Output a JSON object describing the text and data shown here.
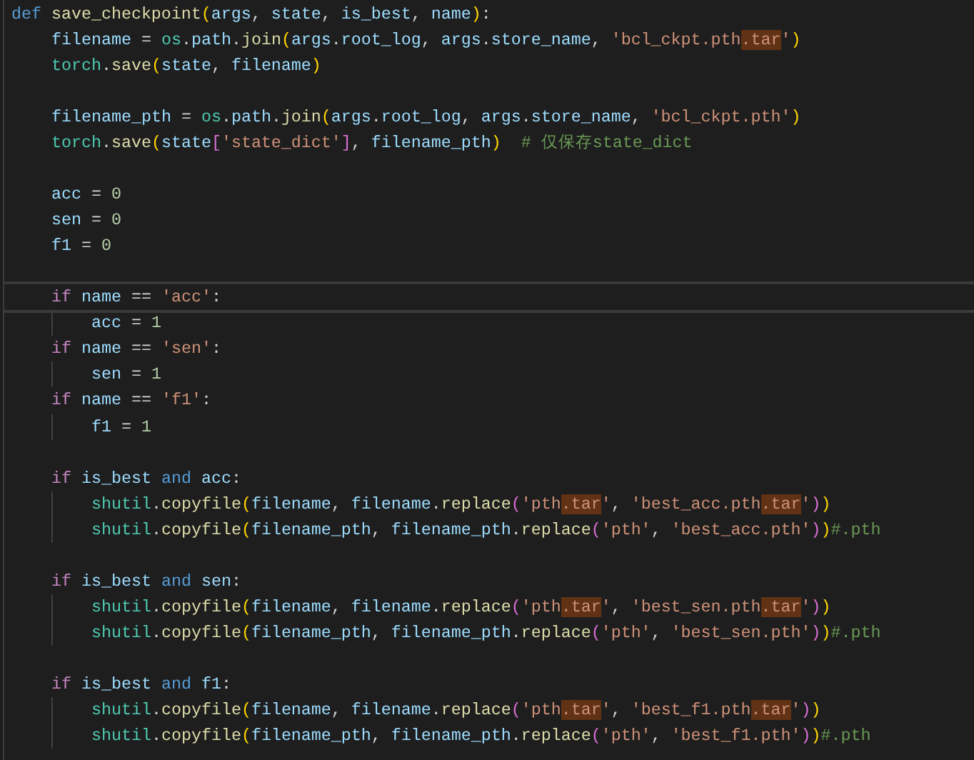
{
  "editor": {
    "lines": [
      {
        "kind": "code",
        "current": false,
        "tokens": [
          {
            "kind": "kw",
            "text": "def "
          },
          {
            "kind": "fn",
            "text": "save_checkpoint"
          },
          {
            "kind": "b1",
            "text": "("
          },
          {
            "kind": "var",
            "text": "args"
          },
          {
            "kind": "op",
            "text": ", "
          },
          {
            "kind": "var",
            "text": "state"
          },
          {
            "kind": "op",
            "text": ", "
          },
          {
            "kind": "var",
            "text": "is_best"
          },
          {
            "kind": "op",
            "text": ", "
          },
          {
            "kind": "var",
            "text": "name"
          },
          {
            "kind": "b1",
            "text": ")"
          },
          {
            "kind": "op",
            "text": ":"
          }
        ],
        "children": [
          {
            "kind": "code",
            "current": false,
            "tokens": [
              {
                "kind": "var",
                "text": "filename"
              },
              {
                "kind": "op",
                "text": " = "
              },
              {
                "kind": "mod",
                "text": "os"
              },
              {
                "kind": "op",
                "text": "."
              },
              {
                "kind": "var",
                "text": "path"
              },
              {
                "kind": "op",
                "text": "."
              },
              {
                "kind": "fn",
                "text": "join"
              },
              {
                "kind": "b1",
                "text": "("
              },
              {
                "kind": "var",
                "text": "args"
              },
              {
                "kind": "op",
                "text": "."
              },
              {
                "kind": "var",
                "text": "root_log"
              },
              {
                "kind": "op",
                "text": ", "
              },
              {
                "kind": "var",
                "text": "args"
              },
              {
                "kind": "op",
                "text": "."
              },
              {
                "kind": "var",
                "text": "store_name"
              },
              {
                "kind": "op",
                "text": ", "
              },
              {
                "kind": "str",
                "text": "'bcl_ckpt.pth"
              },
              {
                "kind": "match",
                "text": ".tar"
              },
              {
                "kind": "str",
                "text": "'"
              },
              {
                "kind": "b1",
                "text": ")"
              }
            ]
          },
          {
            "kind": "code",
            "current": false,
            "tokens": [
              {
                "kind": "mod",
                "text": "torch"
              },
              {
                "kind": "op",
                "text": "."
              },
              {
                "kind": "fn",
                "text": "save"
              },
              {
                "kind": "b1",
                "text": "("
              },
              {
                "kind": "var",
                "text": "state"
              },
              {
                "kind": "op",
                "text": ", "
              },
              {
                "kind": "var",
                "text": "filename"
              },
              {
                "kind": "b1",
                "text": ")"
              }
            ]
          },
          {
            "kind": "blank"
          },
          {
            "kind": "code",
            "current": false,
            "tokens": [
              {
                "kind": "var",
                "text": "filename_pth"
              },
              {
                "kind": "op",
                "text": " = "
              },
              {
                "kind": "mod",
                "text": "os"
              },
              {
                "kind": "op",
                "text": "."
              },
              {
                "kind": "var",
                "text": "path"
              },
              {
                "kind": "op",
                "text": "."
              },
              {
                "kind": "fn",
                "text": "join"
              },
              {
                "kind": "b1",
                "text": "("
              },
              {
                "kind": "var",
                "text": "args"
              },
              {
                "kind": "op",
                "text": "."
              },
              {
                "kind": "var",
                "text": "root_log"
              },
              {
                "kind": "op",
                "text": ", "
              },
              {
                "kind": "var",
                "text": "args"
              },
              {
                "kind": "op",
                "text": "."
              },
              {
                "kind": "var",
                "text": "store_name"
              },
              {
                "kind": "op",
                "text": ", "
              },
              {
                "kind": "str",
                "text": "'bcl_ckpt.pth'"
              },
              {
                "kind": "b1",
                "text": ")"
              }
            ]
          },
          {
            "kind": "code",
            "current": false,
            "tokens": [
              {
                "kind": "mod",
                "text": "torch"
              },
              {
                "kind": "op",
                "text": "."
              },
              {
                "kind": "fn",
                "text": "save"
              },
              {
                "kind": "b1",
                "text": "("
              },
              {
                "kind": "var",
                "text": "state"
              },
              {
                "kind": "b2",
                "text": "["
              },
              {
                "kind": "str",
                "text": "'state_dict'"
              },
              {
                "kind": "b2",
                "text": "]"
              },
              {
                "kind": "op",
                "text": ", "
              },
              {
                "kind": "var",
                "text": "filename_pth"
              },
              {
                "kind": "b1",
                "text": ")"
              },
              {
                "kind": "cmt",
                "text": "  # 仅保存state_dict"
              }
            ]
          },
          {
            "kind": "blank"
          },
          {
            "kind": "code",
            "current": false,
            "tokens": [
              {
                "kind": "var",
                "text": "acc"
              },
              {
                "kind": "op",
                "text": " = "
              },
              {
                "kind": "num",
                "text": "0"
              }
            ]
          },
          {
            "kind": "code",
            "current": false,
            "tokens": [
              {
                "kind": "var",
                "text": "sen"
              },
              {
                "kind": "op",
                "text": " = "
              },
              {
                "kind": "num",
                "text": "0"
              }
            ]
          },
          {
            "kind": "code",
            "current": false,
            "tokens": [
              {
                "kind": "var",
                "text": "f1"
              },
              {
                "kind": "op",
                "text": " = "
              },
              {
                "kind": "num",
                "text": "0"
              }
            ]
          },
          {
            "kind": "blank"
          },
          {
            "kind": "code",
            "current": true,
            "tokens": [
              {
                "kind": "ctl",
                "text": "if "
              },
              {
                "kind": "var",
                "text": "name"
              },
              {
                "kind": "op",
                "text": " == "
              },
              {
                "kind": "str",
                "text": "'acc'"
              },
              {
                "kind": "op",
                "text": ":"
              }
            ],
            "children": [
              {
                "kind": "code",
                "current": false,
                "tokens": [
                  {
                    "kind": "var",
                    "text": "acc"
                  },
                  {
                    "kind": "op",
                    "text": " = "
                  },
                  {
                    "kind": "num",
                    "text": "1"
                  }
                ]
              }
            ]
          },
          {
            "kind": "code",
            "current": false,
            "tokens": [
              {
                "kind": "ctl",
                "text": "if "
              },
              {
                "kind": "var",
                "text": "name"
              },
              {
                "kind": "op",
                "text": " == "
              },
              {
                "kind": "str",
                "text": "'sen'"
              },
              {
                "kind": "op",
                "text": ":"
              }
            ],
            "children": [
              {
                "kind": "code",
                "current": false,
                "tokens": [
                  {
                    "kind": "var",
                    "text": "sen"
                  },
                  {
                    "kind": "op",
                    "text": " = "
                  },
                  {
                    "kind": "num",
                    "text": "1"
                  }
                ]
              }
            ]
          },
          {
            "kind": "code",
            "current": false,
            "tokens": [
              {
                "kind": "ctl",
                "text": "if "
              },
              {
                "kind": "var",
                "text": "name"
              },
              {
                "kind": "op",
                "text": " == "
              },
              {
                "kind": "str",
                "text": "'f1'"
              },
              {
                "kind": "op",
                "text": ":"
              }
            ],
            "children": [
              {
                "kind": "code",
                "current": false,
                "tokens": [
                  {
                    "kind": "var",
                    "text": "f1"
                  },
                  {
                    "kind": "op",
                    "text": " = "
                  },
                  {
                    "kind": "num",
                    "text": "1"
                  }
                ]
              }
            ]
          },
          {
            "kind": "blank"
          },
          {
            "kind": "code",
            "current": false,
            "tokens": [
              {
                "kind": "ctl",
                "text": "if "
              },
              {
                "kind": "var",
                "text": "is_best "
              },
              {
                "kind": "kw",
                "text": "and "
              },
              {
                "kind": "var",
                "text": "acc"
              },
              {
                "kind": "op",
                "text": ":"
              }
            ],
            "children": [
              {
                "kind": "code",
                "current": false,
                "tokens": [
                  {
                    "kind": "mod",
                    "text": "shutil"
                  },
                  {
                    "kind": "op",
                    "text": "."
                  },
                  {
                    "kind": "fn",
                    "text": "copyfile"
                  },
                  {
                    "kind": "b1",
                    "text": "("
                  },
                  {
                    "kind": "var",
                    "text": "filename"
                  },
                  {
                    "kind": "op",
                    "text": ", "
                  },
                  {
                    "kind": "var",
                    "text": "filename"
                  },
                  {
                    "kind": "op",
                    "text": "."
                  },
                  {
                    "kind": "fn",
                    "text": "replace"
                  },
                  {
                    "kind": "b2",
                    "text": "("
                  },
                  {
                    "kind": "str",
                    "text": "'pth"
                  },
                  {
                    "kind": "match",
                    "text": ".tar"
                  },
                  {
                    "kind": "str",
                    "text": "'"
                  },
                  {
                    "kind": "op",
                    "text": ", "
                  },
                  {
                    "kind": "str",
                    "text": "'best_acc.pth"
                  },
                  {
                    "kind": "match",
                    "text": ".tar"
                  },
                  {
                    "kind": "str",
                    "text": "'"
                  },
                  {
                    "kind": "b2",
                    "text": ")"
                  },
                  {
                    "kind": "b1",
                    "text": ")"
                  }
                ]
              },
              {
                "kind": "code",
                "current": false,
                "tokens": [
                  {
                    "kind": "mod",
                    "text": "shutil"
                  },
                  {
                    "kind": "op",
                    "text": "."
                  },
                  {
                    "kind": "fn",
                    "text": "copyfile"
                  },
                  {
                    "kind": "b1",
                    "text": "("
                  },
                  {
                    "kind": "var",
                    "text": "filename_pth"
                  },
                  {
                    "kind": "op",
                    "text": ", "
                  },
                  {
                    "kind": "var",
                    "text": "filename_pth"
                  },
                  {
                    "kind": "op",
                    "text": "."
                  },
                  {
                    "kind": "fn",
                    "text": "replace"
                  },
                  {
                    "kind": "b2",
                    "text": "("
                  },
                  {
                    "kind": "str",
                    "text": "'pth'"
                  },
                  {
                    "kind": "op",
                    "text": ", "
                  },
                  {
                    "kind": "str",
                    "text": "'best_acc.pth'"
                  },
                  {
                    "kind": "b2",
                    "text": ")"
                  },
                  {
                    "kind": "b1",
                    "text": ")"
                  },
                  {
                    "kind": "cmt",
                    "text": "#.pth"
                  }
                ]
              }
            ]
          },
          {
            "kind": "blank"
          },
          {
            "kind": "code",
            "current": false,
            "tokens": [
              {
                "kind": "ctl",
                "text": "if "
              },
              {
                "kind": "var",
                "text": "is_best "
              },
              {
                "kind": "kw",
                "text": "and "
              },
              {
                "kind": "var",
                "text": "sen"
              },
              {
                "kind": "op",
                "text": ":"
              }
            ],
            "children": [
              {
                "kind": "code",
                "current": false,
                "tokens": [
                  {
                    "kind": "mod",
                    "text": "shutil"
                  },
                  {
                    "kind": "op",
                    "text": "."
                  },
                  {
                    "kind": "fn",
                    "text": "copyfile"
                  },
                  {
                    "kind": "b1",
                    "text": "("
                  },
                  {
                    "kind": "var",
                    "text": "filename"
                  },
                  {
                    "kind": "op",
                    "text": ", "
                  },
                  {
                    "kind": "var",
                    "text": "filename"
                  },
                  {
                    "kind": "op",
                    "text": "."
                  },
                  {
                    "kind": "fn",
                    "text": "replace"
                  },
                  {
                    "kind": "b2",
                    "text": "("
                  },
                  {
                    "kind": "str",
                    "text": "'pth"
                  },
                  {
                    "kind": "match",
                    "text": ".tar"
                  },
                  {
                    "kind": "str",
                    "text": "'"
                  },
                  {
                    "kind": "op",
                    "text": ", "
                  },
                  {
                    "kind": "str",
                    "text": "'best_sen.pth"
                  },
                  {
                    "kind": "match",
                    "text": ".tar"
                  },
                  {
                    "kind": "str",
                    "text": "'"
                  },
                  {
                    "kind": "b2",
                    "text": ")"
                  },
                  {
                    "kind": "b1",
                    "text": ")"
                  }
                ]
              },
              {
                "kind": "code",
                "current": false,
                "tokens": [
                  {
                    "kind": "mod",
                    "text": "shutil"
                  },
                  {
                    "kind": "op",
                    "text": "."
                  },
                  {
                    "kind": "fn",
                    "text": "copyfile"
                  },
                  {
                    "kind": "b1",
                    "text": "("
                  },
                  {
                    "kind": "var",
                    "text": "filename_pth"
                  },
                  {
                    "kind": "op",
                    "text": ", "
                  },
                  {
                    "kind": "var",
                    "text": "filename_pth"
                  },
                  {
                    "kind": "op",
                    "text": "."
                  },
                  {
                    "kind": "fn",
                    "text": "replace"
                  },
                  {
                    "kind": "b2",
                    "text": "("
                  },
                  {
                    "kind": "str",
                    "text": "'pth'"
                  },
                  {
                    "kind": "op",
                    "text": ", "
                  },
                  {
                    "kind": "str",
                    "text": "'best_sen.pth'"
                  },
                  {
                    "kind": "b2",
                    "text": ")"
                  },
                  {
                    "kind": "b1",
                    "text": ")"
                  },
                  {
                    "kind": "cmt",
                    "text": "#.pth"
                  }
                ]
              }
            ]
          },
          {
            "kind": "blank"
          },
          {
            "kind": "code",
            "current": false,
            "tokens": [
              {
                "kind": "ctl",
                "text": "if "
              },
              {
                "kind": "var",
                "text": "is_best "
              },
              {
                "kind": "kw",
                "text": "and "
              },
              {
                "kind": "var",
                "text": "f1"
              },
              {
                "kind": "op",
                "text": ":"
              }
            ],
            "children": [
              {
                "kind": "code",
                "current": false,
                "tokens": [
                  {
                    "kind": "mod",
                    "text": "shutil"
                  },
                  {
                    "kind": "op",
                    "text": "."
                  },
                  {
                    "kind": "fn",
                    "text": "copyfile"
                  },
                  {
                    "kind": "b1",
                    "text": "("
                  },
                  {
                    "kind": "var",
                    "text": "filename"
                  },
                  {
                    "kind": "op",
                    "text": ", "
                  },
                  {
                    "kind": "var",
                    "text": "filename"
                  },
                  {
                    "kind": "op",
                    "text": "."
                  },
                  {
                    "kind": "fn",
                    "text": "replace"
                  },
                  {
                    "kind": "b2",
                    "text": "("
                  },
                  {
                    "kind": "str",
                    "text": "'pth"
                  },
                  {
                    "kind": "match",
                    "text": ".tar"
                  },
                  {
                    "kind": "str",
                    "text": "'"
                  },
                  {
                    "kind": "op",
                    "text": ", "
                  },
                  {
                    "kind": "str",
                    "text": "'best_f1.pth"
                  },
                  {
                    "kind": "match",
                    "text": ".tar"
                  },
                  {
                    "kind": "str",
                    "text": "'"
                  },
                  {
                    "kind": "b2",
                    "text": ")"
                  },
                  {
                    "kind": "b1",
                    "text": ")"
                  }
                ]
              },
              {
                "kind": "code",
                "current": false,
                "tokens": [
                  {
                    "kind": "mod",
                    "text": "shutil"
                  },
                  {
                    "kind": "op",
                    "text": "."
                  },
                  {
                    "kind": "fn",
                    "text": "copyfile"
                  },
                  {
                    "kind": "b1",
                    "text": "("
                  },
                  {
                    "kind": "var",
                    "text": "filename_pth"
                  },
                  {
                    "kind": "op",
                    "text": ", "
                  },
                  {
                    "kind": "var",
                    "text": "filename_pth"
                  },
                  {
                    "kind": "op",
                    "text": "."
                  },
                  {
                    "kind": "fn",
                    "text": "replace"
                  },
                  {
                    "kind": "b2",
                    "text": "("
                  },
                  {
                    "kind": "str",
                    "text": "'pth'"
                  },
                  {
                    "kind": "op",
                    "text": ", "
                  },
                  {
                    "kind": "str",
                    "text": "'best_f1.pth'"
                  },
                  {
                    "kind": "b2",
                    "text": ")"
                  },
                  {
                    "kind": "b1",
                    "text": ")"
                  },
                  {
                    "kind": "cmt",
                    "text": "#.pth"
                  }
                ]
              }
            ]
          }
        ]
      }
    ]
  }
}
